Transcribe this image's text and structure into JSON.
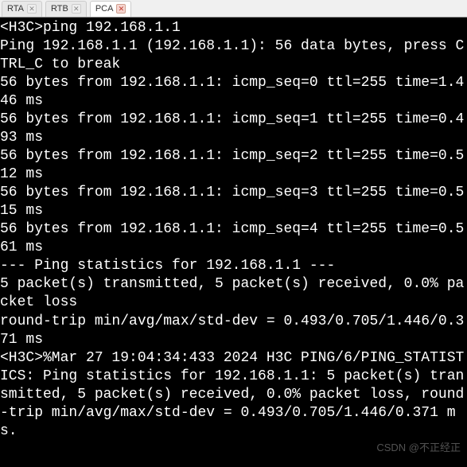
{
  "tabs": [
    {
      "label": "RTA",
      "active": false,
      "closeStyle": "grey"
    },
    {
      "label": "RTB",
      "active": false,
      "closeStyle": "grey"
    },
    {
      "label": "PCA",
      "active": true,
      "closeStyle": "red"
    }
  ],
  "terminal": {
    "lines": [
      "<H3C>ping 192.168.1.1",
      "Ping 192.168.1.1 (192.168.1.1): 56 data bytes, press CTRL_C to break",
      "56 bytes from 192.168.1.1: icmp_seq=0 ttl=255 time=1.446 ms",
      "56 bytes from 192.168.1.1: icmp_seq=1 ttl=255 time=0.493 ms",
      "56 bytes from 192.168.1.1: icmp_seq=2 ttl=255 time=0.512 ms",
      "56 bytes from 192.168.1.1: icmp_seq=3 ttl=255 time=0.515 ms",
      "56 bytes from 192.168.1.1: icmp_seq=4 ttl=255 time=0.561 ms",
      "",
      "--- Ping statistics for 192.168.1.1 ---",
      "5 packet(s) transmitted, 5 packet(s) received, 0.0% packet loss",
      "round-trip min/avg/max/std-dev = 0.493/0.705/1.446/0.371 ms",
      "<H3C>%Mar 27 19:04:34:433 2024 H3C PING/6/PING_STATISTICS: Ping statistics for 192.168.1.1: 5 packet(s) transmitted, 5 packet(s) received, 0.0% packet loss, round-trip min/avg/max/std-dev = 0.493/0.705/1.446/0.371 ms."
    ]
  },
  "watermark": "CSDN @不正经正"
}
